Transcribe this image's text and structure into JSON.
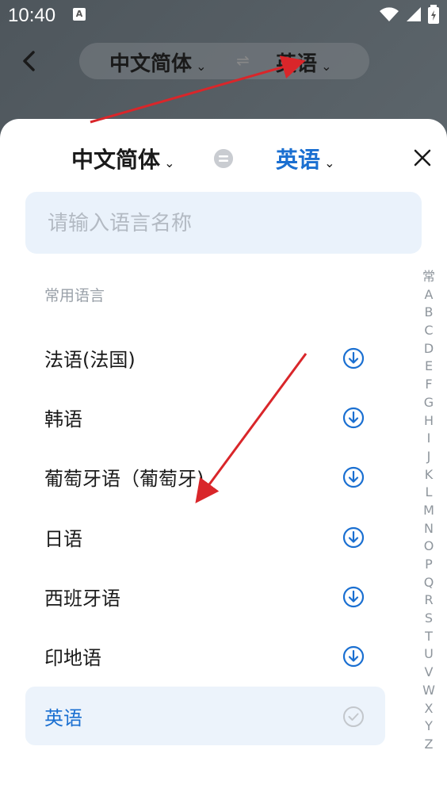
{
  "status_bar": {
    "time": "10:40",
    "notif_label": "A"
  },
  "background": {
    "source_lang": "中文简体",
    "target_lang": "英语",
    "swap_glyph": "⇌"
  },
  "sheet": {
    "source_lang": "中文简体",
    "target_lang": "英语",
    "search_placeholder": "请输入语言名称",
    "section_title": "常用语言",
    "languages": [
      {
        "label": "法语(法国)",
        "status": "download"
      },
      {
        "label": "韩语",
        "status": "download"
      },
      {
        "label": "葡萄牙语（葡萄牙)",
        "status": "download"
      },
      {
        "label": "日语",
        "status": "download"
      },
      {
        "label": "西班牙语",
        "status": "download"
      },
      {
        "label": "印地语",
        "status": "download"
      },
      {
        "label": "英语",
        "status": "downloaded",
        "selected": true
      }
    ],
    "index": [
      "常",
      "A",
      "B",
      "C",
      "D",
      "E",
      "F",
      "G",
      "H",
      "I",
      "J",
      "K",
      "L",
      "M",
      "N",
      "O",
      "P",
      "Q",
      "R",
      "S",
      "T",
      "U",
      "V",
      "W",
      "X",
      "Y",
      "Z"
    ]
  },
  "colors": {
    "accent": "#1a6fd1",
    "annotation": "#d9262a"
  }
}
